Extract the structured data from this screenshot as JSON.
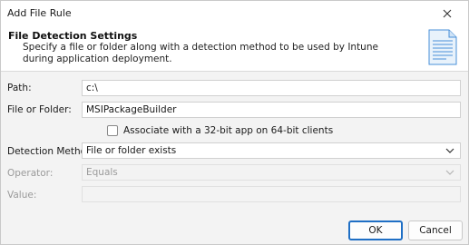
{
  "window": {
    "title": "Add File Rule"
  },
  "header": {
    "title": "File Detection Settings",
    "description": "Specify a file or folder along with a detection method to be used by Intune during application deployment."
  },
  "form": {
    "path": {
      "label": "Path:",
      "value": "c:\\"
    },
    "file_or_folder": {
      "label": "File or Folder:",
      "value": "MSIPackageBuilder"
    },
    "associate_32bit": {
      "label": "Associate with a 32-bit app on 64-bit clients",
      "checked": false
    },
    "detection_method": {
      "label": "Detection Method:",
      "value": "File or folder exists"
    },
    "operator": {
      "label": "Operator:",
      "value": "Equals",
      "disabled": true
    },
    "value": {
      "label": "Value:",
      "value": "",
      "disabled": true
    }
  },
  "buttons": {
    "ok": "OK",
    "cancel": "Cancel"
  },
  "icons": {
    "close": "close-icon",
    "document": "document-icon",
    "dropdown": "chevron-down-icon"
  },
  "colors": {
    "primary_button_border": "#1f6fc5",
    "header_bg": "#ffffff",
    "body_bg": "#f3f3f3"
  }
}
